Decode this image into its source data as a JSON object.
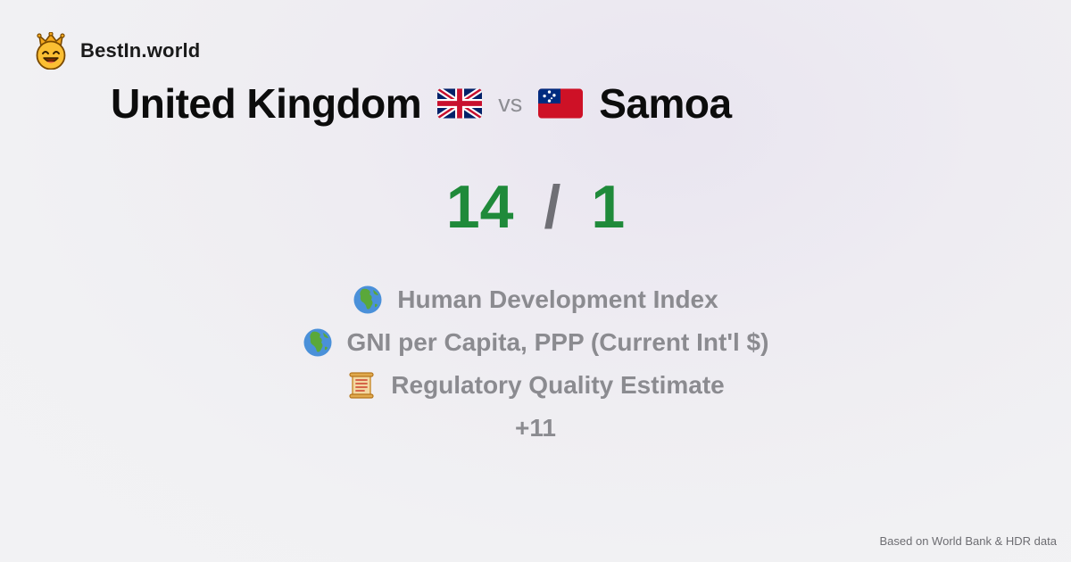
{
  "brand": {
    "name": "BestIn.world",
    "logo_icon": "smiling-king-crown-icon"
  },
  "comparison": {
    "left_country": "United Kingdom",
    "left_flag_icon": "uk-flag-icon",
    "vs_label": "vs",
    "right_country": "Samoa",
    "right_flag_icon": "samoa-flag-icon"
  },
  "score": {
    "left": "14",
    "separator": "/",
    "right": "1",
    "color": "#1f8a3a"
  },
  "metrics": [
    {
      "label": "Human Development Index",
      "icon": "globe-africa-icon"
    },
    {
      "label": "GNI per Capita, PPP (Current Int'l $)",
      "icon": "globe-africa-icon"
    },
    {
      "label": "Regulatory Quality Estimate",
      "icon": "scroll-icon"
    }
  ],
  "more_label": "+11",
  "footer": {
    "source": "Based on World Bank & HDR data"
  }
}
